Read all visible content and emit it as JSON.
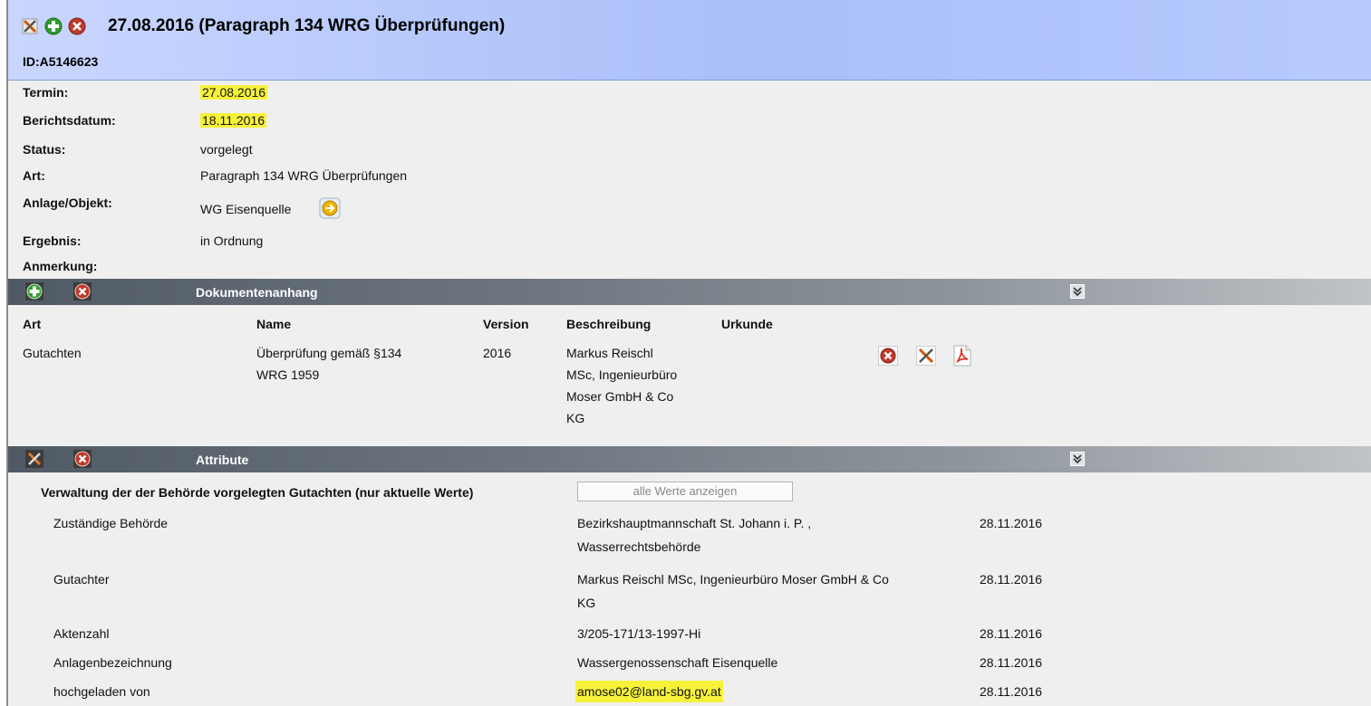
{
  "header": {
    "title": "27.08.2016 (Paragraph 134 WRG Überprüfungen)",
    "id": "ID:A5146623"
  },
  "details": {
    "termin_label": "Termin:",
    "termin_value": "27.08.2016",
    "berichtsdatum_label": "Berichtsdatum:",
    "berichtsdatum_value": "18.11.2016",
    "status_label": "Status:",
    "status_value": "vorgelegt",
    "art_label": "Art:",
    "art_value": "Paragraph 134 WRG Überprüfungen",
    "anlage_label": "Anlage/Objekt:",
    "anlage_value": "WG Eisenquelle",
    "ergebnis_label": "Ergebnis:",
    "ergebnis_value": "in Ordnung",
    "anmerkung_label": "Anmerkung:"
  },
  "documents": {
    "section_title": "Dokumentenanhang",
    "columns": [
      "Art",
      "Name",
      "Version",
      "Beschreibung",
      "Urkunde"
    ],
    "row": {
      "art": "Gutachten",
      "name_line1": "Überprüfung gemäß §134",
      "name_line2": "WRG 1959",
      "version": "2016",
      "desc_line1": "Markus Reischl",
      "desc_line2": "MSc, Ingenieurbüro",
      "desc_line3": "Moser GmbH & Co",
      "desc_line4": "KG"
    }
  },
  "attributes": {
    "section_title": "Attribute",
    "group_title": "Verwaltung der der Behörde vorgelegten Gutachten (nur aktuelle Werte)",
    "show_all_button": "alle Werte anzeigen",
    "rows": [
      {
        "name": "Zuständige Behörde",
        "value_line1": "Bezirkshauptmannschaft St. Johann i. P. ,",
        "value_line2": "Wasserrechtsbehörde",
        "date": "28.11.2016"
      },
      {
        "name": "Gutachter",
        "value_line1": "Markus Reischl MSc, Ingenieurbüro Moser GmbH & Co",
        "value_line2": "KG",
        "date": "28.11.2016"
      },
      {
        "name": "Aktenzahl",
        "value_line1": "3/205-171/13-1997-Hi",
        "value_line2": "",
        "date": "28.11.2016"
      },
      {
        "name": "Anlagenbezeichnung",
        "value_line1": "Wassergenossenschaft Eisenquelle",
        "value_line2": "",
        "date": "28.11.2016"
      },
      {
        "name": "hochgeladen von",
        "value_line1": "amose02@land-sbg.gv.at",
        "value_line2": "",
        "date": "28.11.2016"
      }
    ]
  },
  "colors": {
    "highlight": "#f6f23a",
    "header_blue": "#a9bff8",
    "section_bar": "#6f7881",
    "add_green": "#2e9e2e",
    "delete_red": "#c0392b"
  },
  "icons": {
    "edit": "tools-icon",
    "add": "add-icon",
    "delete": "delete-icon",
    "pdf": "pdf-icon",
    "go": "arrow-right-icon",
    "expand": "expand-icon"
  }
}
